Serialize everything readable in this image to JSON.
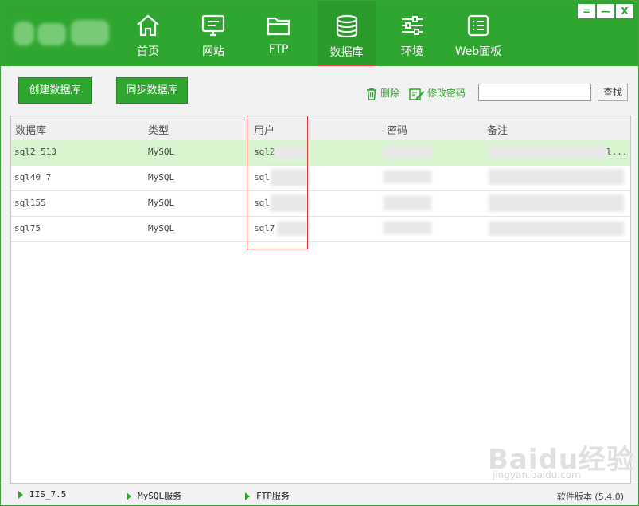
{
  "nav": {
    "items": [
      {
        "label": "首页",
        "icon": "home-icon"
      },
      {
        "label": "网站",
        "icon": "monitor-icon"
      },
      {
        "label": "FTP",
        "icon": "folder-icon"
      },
      {
        "label": "数据库",
        "icon": "database-icon",
        "active": true
      },
      {
        "label": "环境",
        "icon": "sliders-icon"
      },
      {
        "label": "Web面板",
        "icon": "panel-list-icon"
      }
    ]
  },
  "window_controls": {
    "pin": "=",
    "minimize": "—",
    "close": "X"
  },
  "toolbar": {
    "create_db": "创建数据库",
    "sync_db": "同步数据库",
    "delete": "删除",
    "change_password": "修改密码",
    "search_value": "",
    "find": "查找"
  },
  "table": {
    "headers": [
      "数据库",
      "类型",
      "用户",
      "密码",
      "备注"
    ],
    "rows": [
      {
        "db": "sql2 513",
        "type": "MySQL",
        "user": "sql2",
        "password": "",
        "note": "l..."
      },
      {
        "db": "sql40 7",
        "type": "MySQL",
        "user": "sql",
        "password": "",
        "note": ""
      },
      {
        "db": "sql155",
        "type": "MySQL",
        "user": "sql",
        "password": "",
        "note": ""
      },
      {
        "db": "sql75",
        "type": "MySQL",
        "user": "sql7",
        "password": "",
        "note": ""
      }
    ]
  },
  "status": {
    "services": [
      "IIS_7.5",
      "MySQL服务",
      "FTP服务"
    ],
    "version": "软件版本 (5.4.0)"
  },
  "watermark": {
    "logo": "Baidu经验",
    "url": "jingyan.baidu.com"
  },
  "colors": {
    "brand_green": "#2fa62f",
    "selected_row": "#d9f5d0",
    "highlight_red": "#e03b3b"
  }
}
